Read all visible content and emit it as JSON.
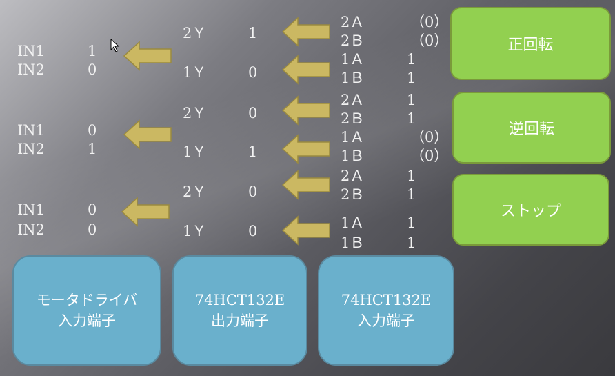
{
  "groups": [
    {
      "in": [
        {
          "label": "IN1",
          "value": "1"
        },
        {
          "label": "IN2",
          "value": "0"
        }
      ],
      "y": [
        {
          "label": "2Ｙ",
          "value": "1"
        },
        {
          "label": "1Ｙ",
          "value": "0"
        }
      ],
      "inputs": [
        {
          "label": "2Ａ",
          "value": "（0）"
        },
        {
          "label": "2Ｂ",
          "value": "（0）"
        },
        {
          "label": "1Ａ",
          "value": "1"
        },
        {
          "label": "1Ｂ",
          "value": "1"
        }
      ]
    },
    {
      "in": [
        {
          "label": "IN1",
          "value": "0"
        },
        {
          "label": "IN2",
          "value": "1"
        }
      ],
      "y": [
        {
          "label": "2Ｙ",
          "value": "0"
        },
        {
          "label": "1Ｙ",
          "value": "1"
        }
      ],
      "inputs": [
        {
          "label": "2Ａ",
          "value": "1"
        },
        {
          "label": "2Ｂ",
          "value": "1"
        },
        {
          "label": "1Ａ",
          "value": "（0）"
        },
        {
          "label": "1Ｂ",
          "value": "（0）"
        }
      ]
    },
    {
      "in": [
        {
          "label": "IN1",
          "value": "0"
        },
        {
          "label": "IN2",
          "value": "0"
        }
      ],
      "y": [
        {
          "label": "2Ｙ",
          "value": "0"
        },
        {
          "label": "1Ｙ",
          "value": "0"
        }
      ],
      "inputs": [
        {
          "label": "2Ａ",
          "value": "1"
        },
        {
          "label": "2Ｂ",
          "value": "1"
        },
        {
          "label": "1Ａ",
          "value": "1"
        },
        {
          "label": "1Ｂ",
          "value": "1"
        }
      ]
    }
  ],
  "buttons": {
    "forward": "正回転",
    "reverse": "逆回転",
    "stop": "ストップ"
  },
  "boxes": {
    "driver": {
      "line1": "モータドライバ",
      "line2": "入力端子"
    },
    "out": {
      "line1": "74HCT132E",
      "line2": "出力端子"
    },
    "in": {
      "line1": "74HCT132E",
      "line2": "入力端子"
    }
  },
  "colors": {
    "button_green": "#92d050",
    "box_blue": "#6ab0cc",
    "arrow_gold": "#cbb862"
  }
}
